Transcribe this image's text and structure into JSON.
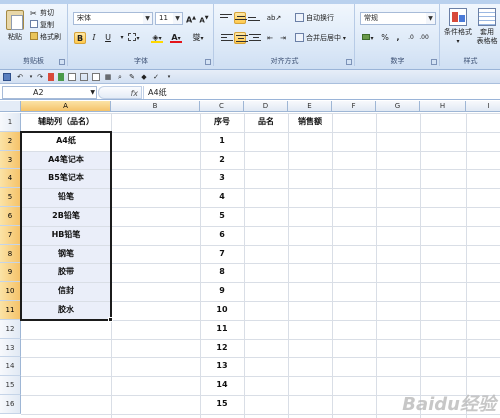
{
  "ribbon": {
    "clipboard": {
      "paste_label": "粘贴",
      "cut_label": "剪切",
      "copy_label": "复制",
      "format_painter_label": "格式刷",
      "group_label": "剪贴板"
    },
    "font": {
      "font_name": "宋体",
      "font_size": "11",
      "grow_label": "A",
      "shrink_label": "A",
      "bold_label": "B",
      "italic_label": "I",
      "underline_label": "U",
      "font_color_label": "A",
      "phonetic_label": "燮",
      "fill_color": "#ffd800",
      "font_color": "#e3141a",
      "group_label": "字体"
    },
    "alignment": {
      "wrap_label": "自动换行",
      "merge_label": "合并后居中",
      "group_label": "对齐方式"
    },
    "number": {
      "format_value": "常规",
      "percent_label": "%",
      "comma_label": ",",
      "group_label": "数字"
    },
    "styles": {
      "conditional_label": "条件格式",
      "table_label": "套用\n表格格",
      "group_label": "样式"
    }
  },
  "formula_bar": {
    "name_box": "A2",
    "fx_label": "fx",
    "content": "A4纸"
  },
  "sheet": {
    "columns": [
      "A",
      "B",
      "C",
      "D",
      "E",
      "F",
      "G",
      "H",
      "I"
    ],
    "rows": [
      "1",
      "2",
      "3",
      "4",
      "5",
      "6",
      "7",
      "8",
      "9",
      "10",
      "11",
      "12",
      "13",
      "14",
      "15",
      "16"
    ],
    "a1": "辅助列（品名）",
    "col_a_items": [
      "A4纸",
      "A4笔记本",
      "B5笔记本",
      "铅笔",
      "2B铅笔",
      "HB铅笔",
      "钢笔",
      "胶带",
      "信封",
      "胶水"
    ],
    "c1": "序号",
    "d1": "品名",
    "e1": "销售额",
    "col_c_numbers": [
      "1",
      "2",
      "3",
      "4",
      "5",
      "6",
      "7",
      "8",
      "9",
      "10",
      "11",
      "12",
      "13",
      "14",
      "15",
      "16"
    ]
  },
  "watermark": "Baidu经验",
  "colors": {
    "selected_header": "#f5c36a",
    "range_fill": "#eaeef9",
    "ribbon_bg": "#dbe8f7"
  }
}
